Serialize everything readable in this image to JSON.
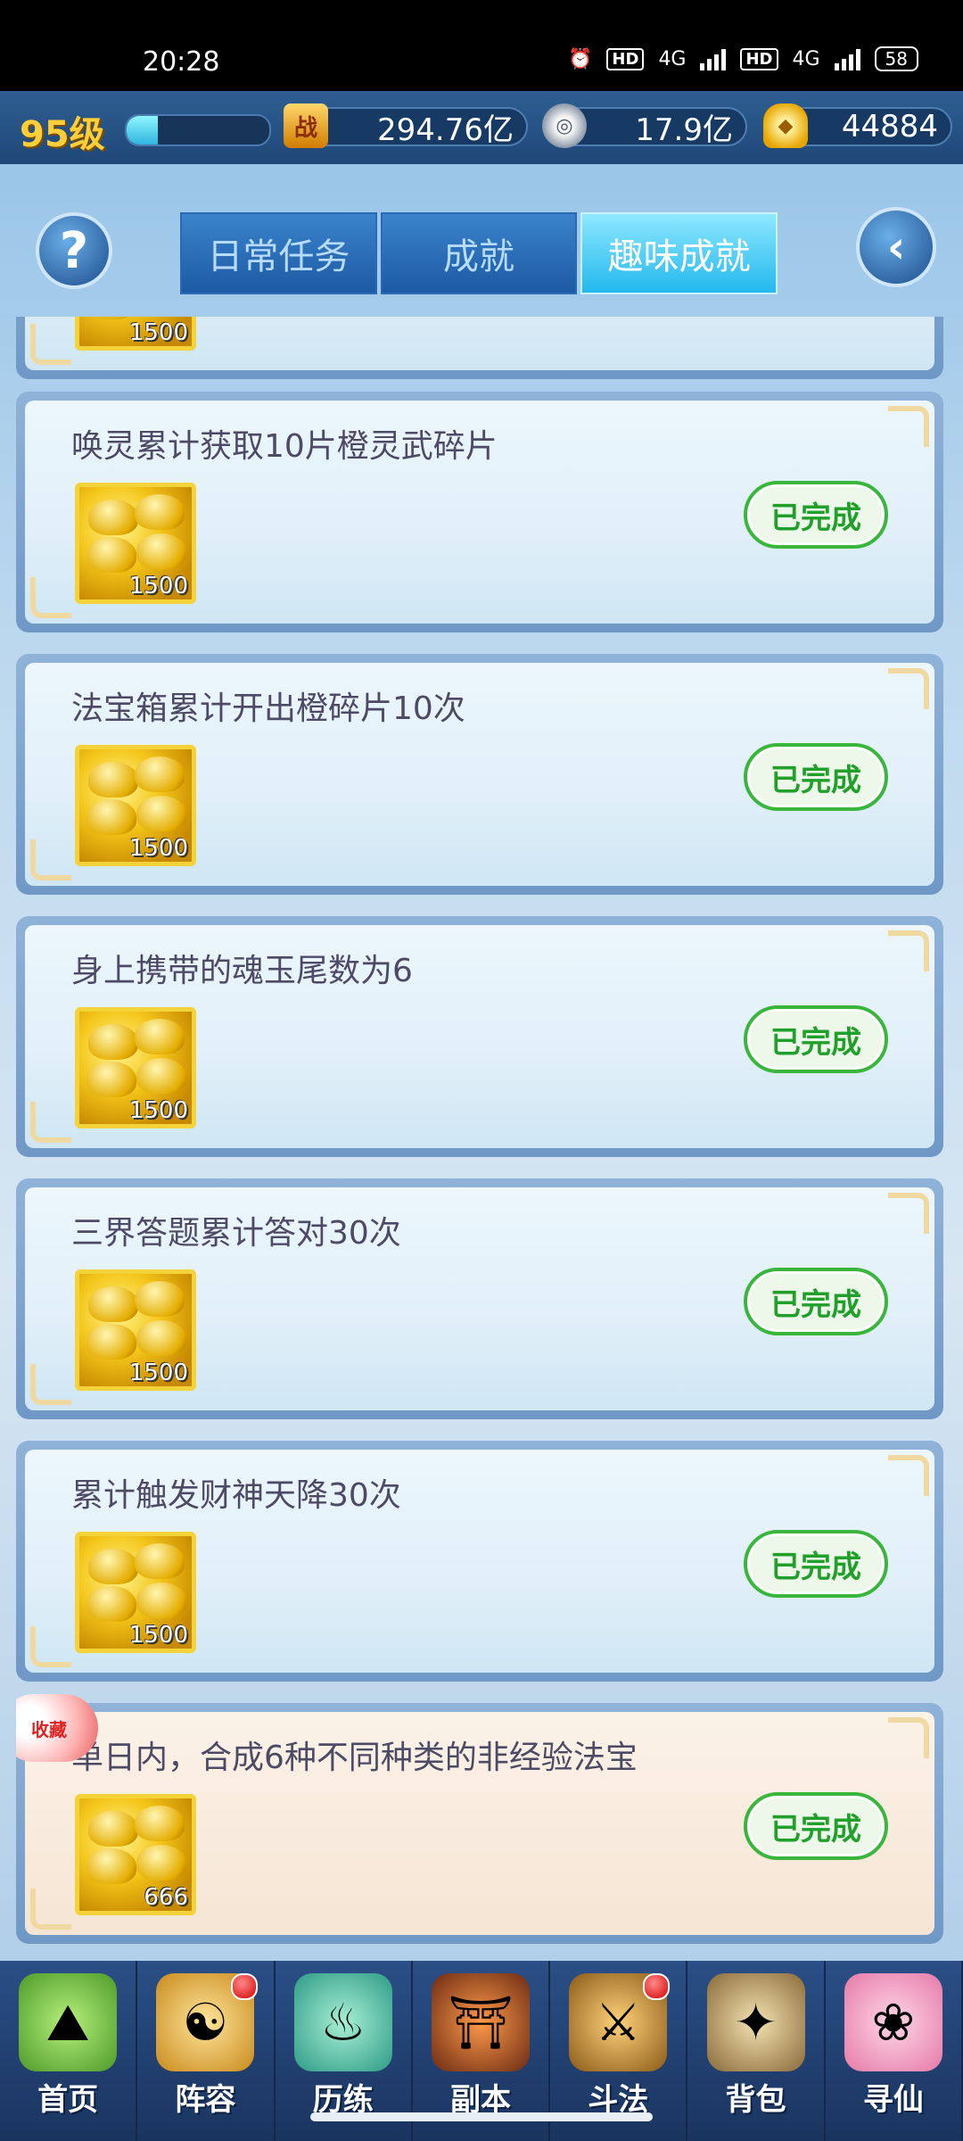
{
  "status_bar": {
    "time": "20:28",
    "network_1": "HD",
    "net_type_1": "4G",
    "network_2": "HD",
    "net_type_2": "4G",
    "battery": "58"
  },
  "top_bar": {
    "level": "95级",
    "xp_fraction": 0.22,
    "combat_icon": "战",
    "combat_power": "294.76亿",
    "silver": "17.9亿",
    "gold": "44884"
  },
  "header": {
    "help_label": "?",
    "tabs": [
      {
        "label": "日常任务",
        "active": false
      },
      {
        "label": "成就",
        "active": false
      },
      {
        "label": "趣味成就",
        "active": true
      }
    ]
  },
  "achievements": [
    {
      "title": "",
      "reward_qty": "1500",
      "status": ""
    },
    {
      "title": "唤灵累计获取10片橙灵武碎片",
      "reward_qty": "1500",
      "status": "已完成"
    },
    {
      "title": "法宝箱累计开出橙碎片10次",
      "reward_qty": "1500",
      "status": "已完成"
    },
    {
      "title": "身上携带的魂玉尾数为6",
      "reward_qty": "1500",
      "status": "已完成"
    },
    {
      "title": "三界答题累计答对30次",
      "reward_qty": "1500",
      "status": "已完成"
    },
    {
      "title": "累计触发财神天降30次",
      "reward_qty": "1500",
      "status": "已完成"
    },
    {
      "title": "单日内，合成6种不同种类的非经验法宝",
      "reward_qty": "666",
      "status": "已完成",
      "badge": "收藏"
    }
  ],
  "bottom_nav": [
    {
      "label": "首页",
      "icon": "home-island-icon",
      "dot": false
    },
    {
      "label": "阵容",
      "icon": "formation-icon",
      "dot": true
    },
    {
      "label": "历练",
      "icon": "training-gourd-icon",
      "dot": false
    },
    {
      "label": "副本",
      "icon": "dungeon-gate-icon",
      "dot": false
    },
    {
      "label": "斗法",
      "icon": "battle-sword-icon",
      "dot": true
    },
    {
      "label": "背包",
      "icon": "bag-icon",
      "dot": false
    },
    {
      "label": "寻仙",
      "icon": "fairy-icon",
      "dot": false
    }
  ],
  "colors": {
    "accent_tab": "#24b8ee",
    "done_green": "#20a02a",
    "gold": "#ffcf3a"
  }
}
